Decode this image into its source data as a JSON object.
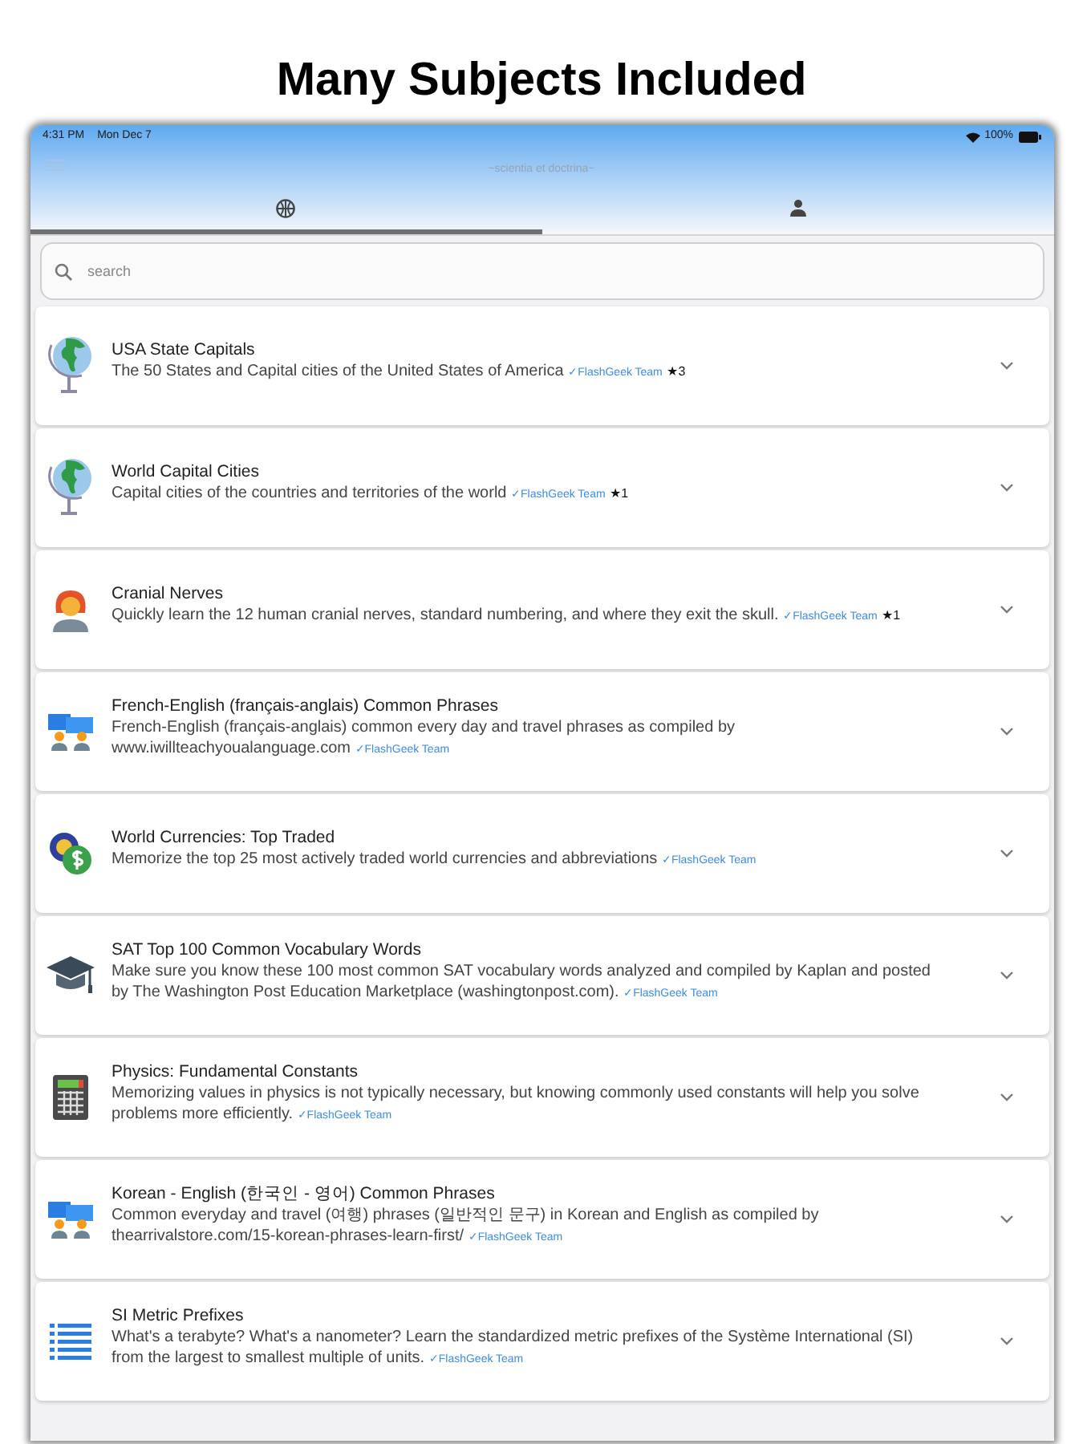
{
  "headline": "Many Subjects Included",
  "status_bar": {
    "time": "4:31 PM",
    "date": "Mon Dec 7",
    "battery": "100%"
  },
  "nav": {
    "title": "~scientia et doctrina~"
  },
  "tabs": [
    {
      "kind": "globe",
      "selected": true
    },
    {
      "kind": "person",
      "selected": false
    }
  ],
  "search": {
    "placeholder": "search"
  },
  "subjects": [
    {
      "kind": "globe",
      "title": "USA State Capitals",
      "description": "The 50 States and Capital cities of the United States of America",
      "author": "✓FlashGeek Team",
      "stars": "★3"
    },
    {
      "kind": "globe",
      "title": "World Capital Cities",
      "description": "Capital cities of the countries and territories of the world",
      "author": "✓FlashGeek Team",
      "stars": "★1"
    },
    {
      "kind": "person",
      "title": "Cranial Nerves",
      "description": "Quickly learn the 12 human cranial nerves, standard numbering, and where they exit the skull.",
      "author": "✓FlashGeek Team",
      "stars": "★1"
    },
    {
      "kind": "chat",
      "title": "French-English (français-anglais) Common Phrases",
      "description": "French-English (français-anglais) common every day and travel phrases as compiled by www.iwillteachyoualanguage.com",
      "author": "✓FlashGeek Team"
    },
    {
      "kind": "currency",
      "title": "World Currencies: Top Traded",
      "description": "Memorize the top 25 most actively traded world currencies and abbreviations",
      "author": "✓FlashGeek Team"
    },
    {
      "kind": "cap",
      "title": "SAT Top 100 Common Vocabulary Words",
      "description": "Make sure you know these 100 most common SAT vocabulary words analyzed and compiled by Kaplan and posted by The Washington Post Education Marketplace (washingtonpost.com).",
      "author": "✓FlashGeek Team"
    },
    {
      "kind": "calculator",
      "title": "Physics: Fundamental Constants",
      "description": "Memorizing values in physics is not typically necessary, but knowing commonly used constants will help you solve problems more efficiently.",
      "author": "✓FlashGeek Team"
    },
    {
      "kind": "chat",
      "title": "Korean - English (한국인 - 영어) Common Phrases",
      "description": "Common everyday and travel (여행) phrases (일반적인 문구) in Korean and English as compiled by thearrivalstore.com/15-korean-phrases-learn-first/",
      "author": "✓FlashGeek Team"
    },
    {
      "kind": "list",
      "title": "SI Metric Prefixes",
      "description": "What's a terabyte? What's a nanometer? Learn the standardized metric prefixes of the Système International (SI) from the largest to smallest multiple of units.",
      "author": "✓FlashGeek Team"
    }
  ]
}
